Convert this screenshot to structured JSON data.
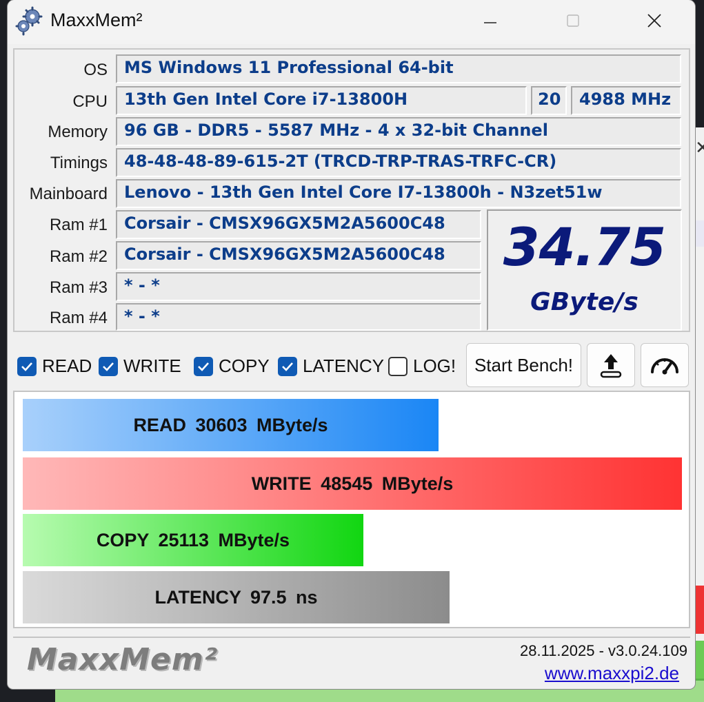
{
  "window": {
    "title": "MaxxMem²"
  },
  "info": {
    "labels": {
      "os": "OS",
      "cpu": "CPU",
      "memory": "Memory",
      "timings": "Timings",
      "mainboard": "Mainboard",
      "ram1": "Ram #1",
      "ram2": "Ram #2",
      "ram3": "Ram #3",
      "ram4": "Ram #4"
    },
    "os": "MS Windows 11 Professional 64-bit",
    "cpu": "13th Gen Intel Core i7-13800H",
    "cpu_threads": "20",
    "cpu_clock": "4988 MHz",
    "memory": "96 GB - DDR5 - 5587 MHz - 4 x 32-bit Channel",
    "timings": "48-48-48-89-615-2T (TRCD-TRP-TRAS-TRFC-CR)",
    "mainboard": "Lenovo - 13th Gen Intel Core I7-13800h - N3zet51w",
    "ram1": "Corsair - CMSX96GX5M2A5600C48",
    "ram2": "Corsair - CMSX96GX5M2A5600C48",
    "ram3": "* - *",
    "ram4": "* - *"
  },
  "result": {
    "value": "34.75",
    "unit": "GByte/s"
  },
  "options": {
    "read": {
      "label": "READ",
      "checked": true
    },
    "write": {
      "label": "WRITE",
      "checked": true
    },
    "copy": {
      "label": "COPY",
      "checked": true
    },
    "latency": {
      "label": "LATENCY",
      "checked": true
    },
    "log": {
      "label": "LOG!",
      "checked": false
    }
  },
  "toolbar": {
    "start_label": "Start Bench!",
    "upload_icon": "upload-icon",
    "gauge_icon": "speedometer-icon"
  },
  "bars": {
    "read": {
      "text": "READ 30603 MByte/s",
      "fraction": 0.631
    },
    "write": {
      "text": "WRITE 48545 MByte/s",
      "fraction": 1.0
    },
    "copy": {
      "text": "COPY 25113 MByte/s",
      "fraction": 0.517
    },
    "latency": {
      "text": "LATENCY 97.5 ns",
      "fraction": 0.647
    }
  },
  "footer": {
    "logo": "MaxxMem²",
    "version": "28.11.2025 - v3.0.24.109",
    "link": "www.maxxpi2.de"
  },
  "colors": {
    "value_blue": "#0b1a7a",
    "field_text": "#0c3d8a",
    "read": "#1a86f5",
    "write": "#ff3333",
    "copy": "#11d611",
    "latency": "#8c8c8c"
  }
}
